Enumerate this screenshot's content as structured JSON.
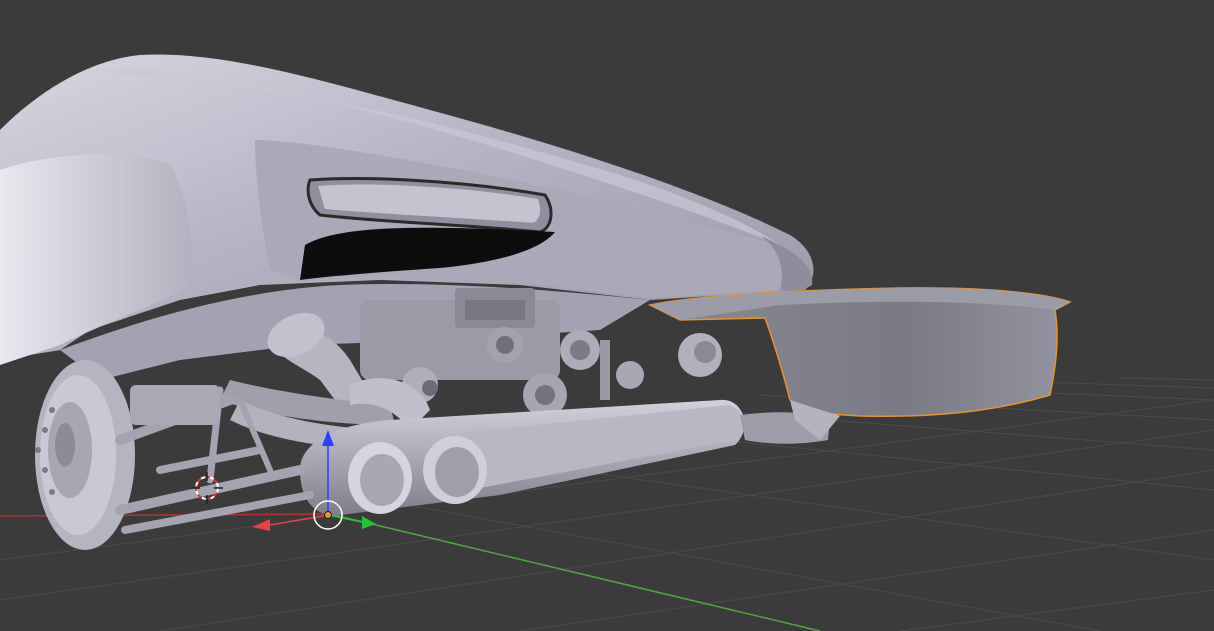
{
  "viewport": {
    "mode": "3D Viewport",
    "shading": "solid",
    "background_color": "#3b3b3b",
    "grid_color": "#4a4a4a",
    "model_color": "#b9b9c6",
    "selection_outline_color": "#e5952c"
  },
  "axes": {
    "x_color": "#b33333",
    "y_color": "#4ea83f",
    "z_color": "#2b2bff"
  },
  "gizmo": {
    "handle_x_color": "#e84141",
    "handle_y_color": "#22c33a",
    "handle_z_color": "#2f3fff",
    "pivot_color": "#e5952c"
  },
  "icons": {
    "cursor": "3d-cursor-icon",
    "gizmo": "translate-gizmo-icon"
  },
  "selected_object": "rear-wing"
}
